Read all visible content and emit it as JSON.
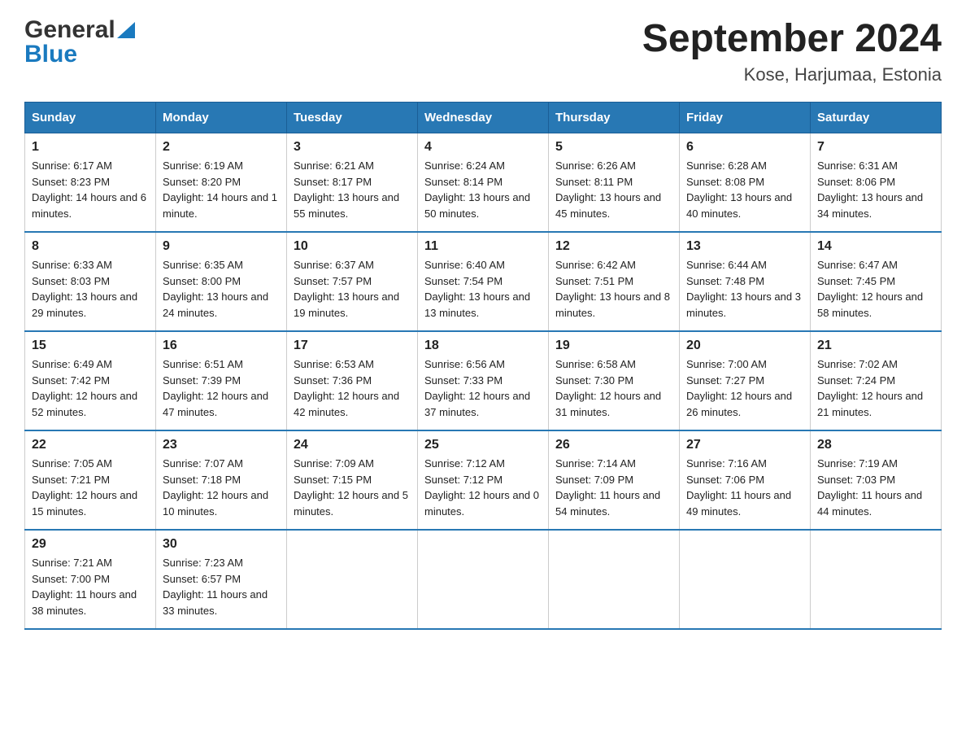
{
  "header": {
    "title": "September 2024",
    "subtitle": "Kose, Harjumaa, Estonia"
  },
  "logo": {
    "line1": "General",
    "line2": "Blue"
  },
  "days_of_week": [
    "Sunday",
    "Monday",
    "Tuesday",
    "Wednesday",
    "Thursday",
    "Friday",
    "Saturday"
  ],
  "weeks": [
    [
      {
        "day": "1",
        "sunrise": "6:17 AM",
        "sunset": "8:23 PM",
        "daylight": "14 hours and 6 minutes."
      },
      {
        "day": "2",
        "sunrise": "6:19 AM",
        "sunset": "8:20 PM",
        "daylight": "14 hours and 1 minute."
      },
      {
        "day": "3",
        "sunrise": "6:21 AM",
        "sunset": "8:17 PM",
        "daylight": "13 hours and 55 minutes."
      },
      {
        "day": "4",
        "sunrise": "6:24 AM",
        "sunset": "8:14 PM",
        "daylight": "13 hours and 50 minutes."
      },
      {
        "day": "5",
        "sunrise": "6:26 AM",
        "sunset": "8:11 PM",
        "daylight": "13 hours and 45 minutes."
      },
      {
        "day": "6",
        "sunrise": "6:28 AM",
        "sunset": "8:08 PM",
        "daylight": "13 hours and 40 minutes."
      },
      {
        "day": "7",
        "sunrise": "6:31 AM",
        "sunset": "8:06 PM",
        "daylight": "13 hours and 34 minutes."
      }
    ],
    [
      {
        "day": "8",
        "sunrise": "6:33 AM",
        "sunset": "8:03 PM",
        "daylight": "13 hours and 29 minutes."
      },
      {
        "day": "9",
        "sunrise": "6:35 AM",
        "sunset": "8:00 PM",
        "daylight": "13 hours and 24 minutes."
      },
      {
        "day": "10",
        "sunrise": "6:37 AM",
        "sunset": "7:57 PM",
        "daylight": "13 hours and 19 minutes."
      },
      {
        "day": "11",
        "sunrise": "6:40 AM",
        "sunset": "7:54 PM",
        "daylight": "13 hours and 13 minutes."
      },
      {
        "day": "12",
        "sunrise": "6:42 AM",
        "sunset": "7:51 PM",
        "daylight": "13 hours and 8 minutes."
      },
      {
        "day": "13",
        "sunrise": "6:44 AM",
        "sunset": "7:48 PM",
        "daylight": "13 hours and 3 minutes."
      },
      {
        "day": "14",
        "sunrise": "6:47 AM",
        "sunset": "7:45 PM",
        "daylight": "12 hours and 58 minutes."
      }
    ],
    [
      {
        "day": "15",
        "sunrise": "6:49 AM",
        "sunset": "7:42 PM",
        "daylight": "12 hours and 52 minutes."
      },
      {
        "day": "16",
        "sunrise": "6:51 AM",
        "sunset": "7:39 PM",
        "daylight": "12 hours and 47 minutes."
      },
      {
        "day": "17",
        "sunrise": "6:53 AM",
        "sunset": "7:36 PM",
        "daylight": "12 hours and 42 minutes."
      },
      {
        "day": "18",
        "sunrise": "6:56 AM",
        "sunset": "7:33 PM",
        "daylight": "12 hours and 37 minutes."
      },
      {
        "day": "19",
        "sunrise": "6:58 AM",
        "sunset": "7:30 PM",
        "daylight": "12 hours and 31 minutes."
      },
      {
        "day": "20",
        "sunrise": "7:00 AM",
        "sunset": "7:27 PM",
        "daylight": "12 hours and 26 minutes."
      },
      {
        "day": "21",
        "sunrise": "7:02 AM",
        "sunset": "7:24 PM",
        "daylight": "12 hours and 21 minutes."
      }
    ],
    [
      {
        "day": "22",
        "sunrise": "7:05 AM",
        "sunset": "7:21 PM",
        "daylight": "12 hours and 15 minutes."
      },
      {
        "day": "23",
        "sunrise": "7:07 AM",
        "sunset": "7:18 PM",
        "daylight": "12 hours and 10 minutes."
      },
      {
        "day": "24",
        "sunrise": "7:09 AM",
        "sunset": "7:15 PM",
        "daylight": "12 hours and 5 minutes."
      },
      {
        "day": "25",
        "sunrise": "7:12 AM",
        "sunset": "7:12 PM",
        "daylight": "12 hours and 0 minutes."
      },
      {
        "day": "26",
        "sunrise": "7:14 AM",
        "sunset": "7:09 PM",
        "daylight": "11 hours and 54 minutes."
      },
      {
        "day": "27",
        "sunrise": "7:16 AM",
        "sunset": "7:06 PM",
        "daylight": "11 hours and 49 minutes."
      },
      {
        "day": "28",
        "sunrise": "7:19 AM",
        "sunset": "7:03 PM",
        "daylight": "11 hours and 44 minutes."
      }
    ],
    [
      {
        "day": "29",
        "sunrise": "7:21 AM",
        "sunset": "7:00 PM",
        "daylight": "11 hours and 38 minutes."
      },
      {
        "day": "30",
        "sunrise": "7:23 AM",
        "sunset": "6:57 PM",
        "daylight": "11 hours and 33 minutes."
      },
      null,
      null,
      null,
      null,
      null
    ]
  ],
  "labels": {
    "sunrise": "Sunrise:",
    "sunset": "Sunset:",
    "daylight": "Daylight:"
  }
}
